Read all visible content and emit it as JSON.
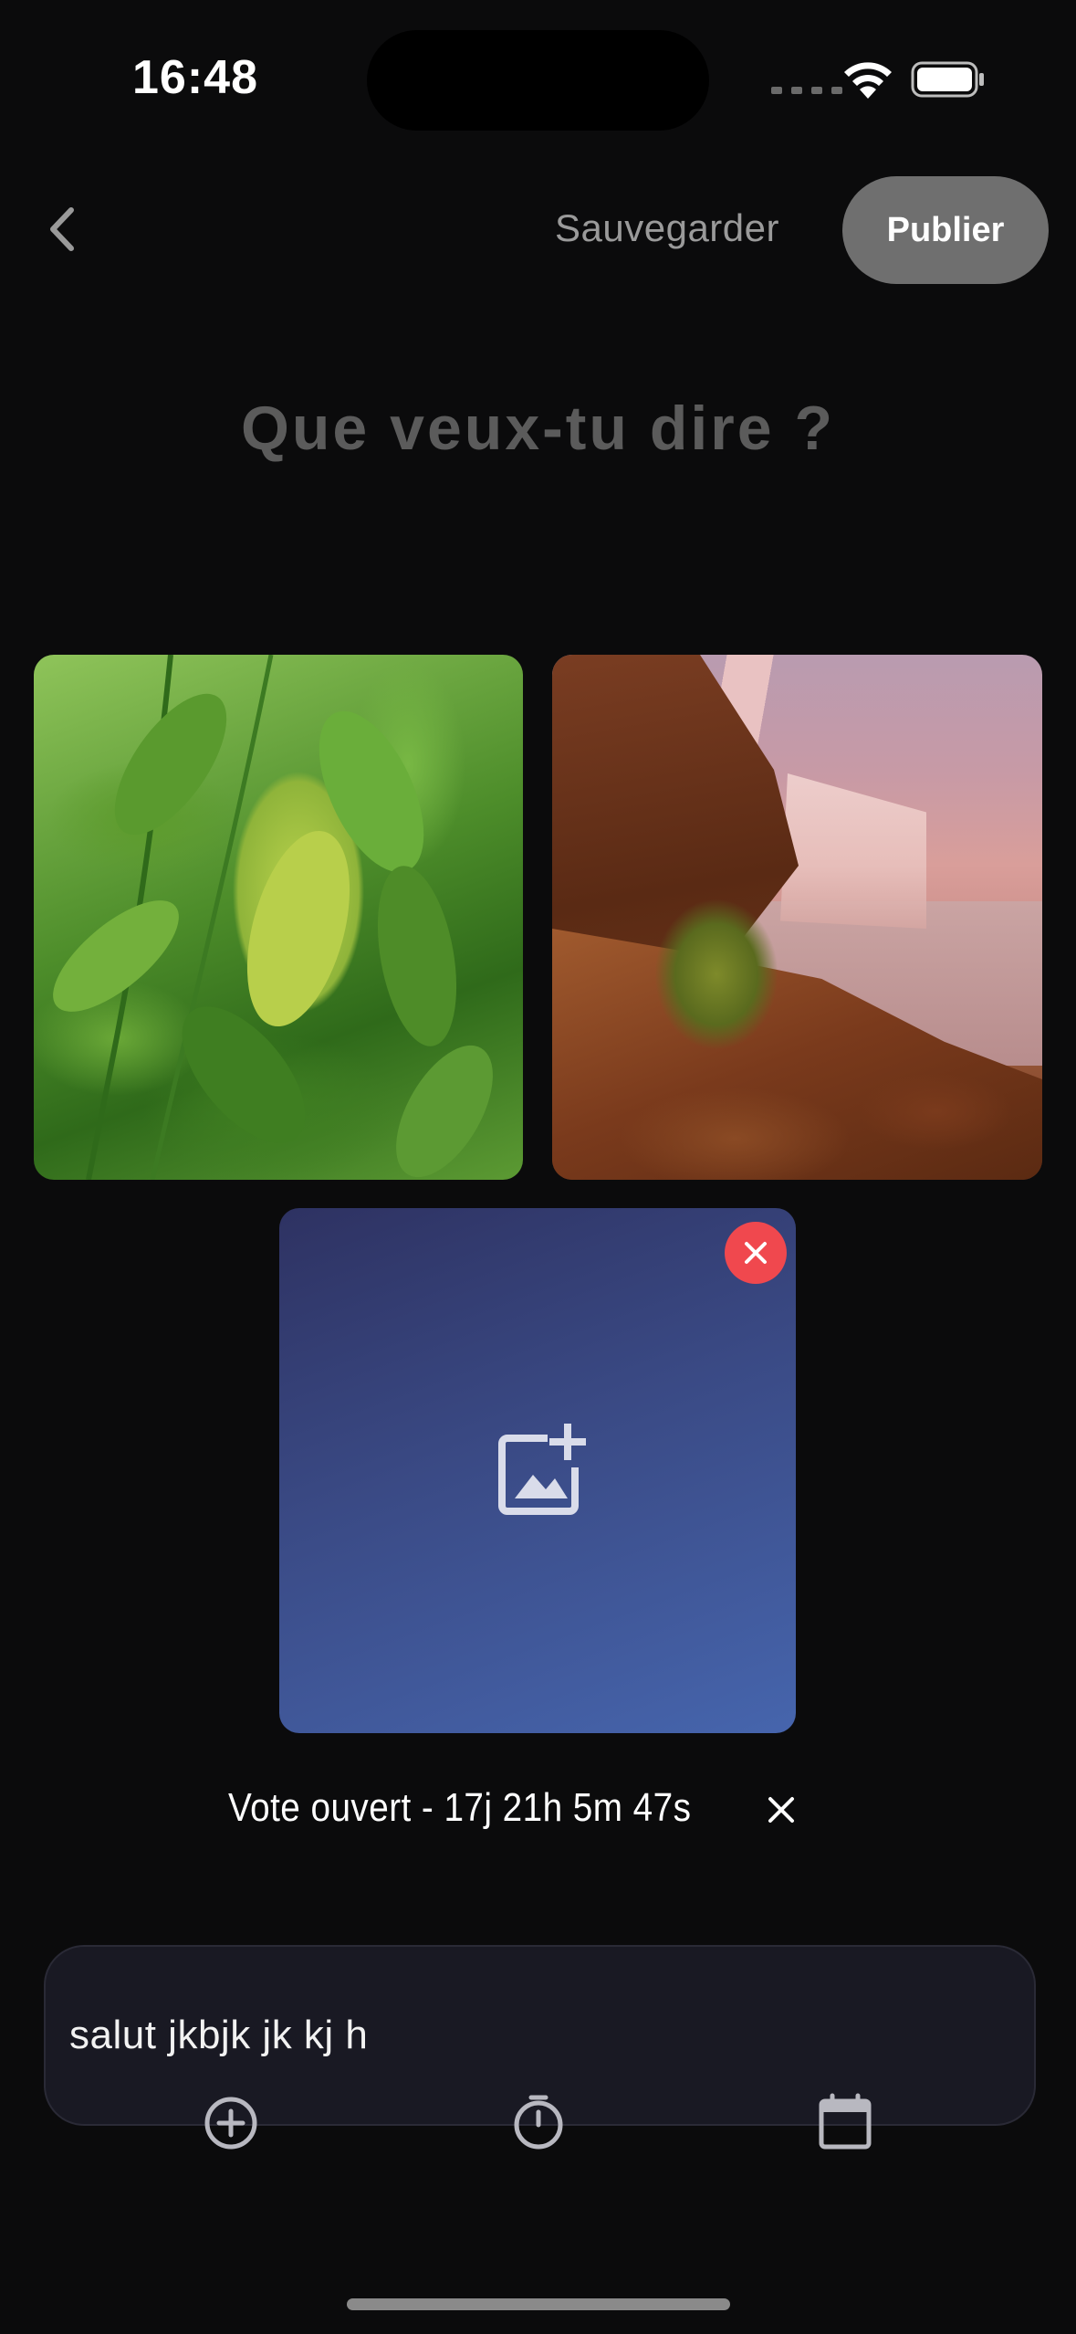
{
  "status_bar": {
    "time": "16:48",
    "icons": [
      "signal-icon",
      "wifi-icon",
      "battery-icon"
    ]
  },
  "header": {
    "back_icon": "chevron-left-icon",
    "save_label": "Sauvegarder",
    "publish_label": "Publier"
  },
  "prompt": {
    "title": "Que veux-tu dire ?"
  },
  "images": [
    {
      "description_icon": "photo-leaves"
    },
    {
      "description_icon": "photo-waterfall"
    }
  ],
  "add_card": {
    "icon": "add-image-icon",
    "remove_icon": "close-icon"
  },
  "vote": {
    "status": "Vote ouvert - ",
    "countdown": "17j 21h 5m 47s",
    "close_icon": "close-icon"
  },
  "composer": {
    "text": "salut jkbjk jk kj h",
    "tools": [
      "add-circle-icon",
      "timer-icon",
      "calendar-icon"
    ]
  },
  "colors": {
    "background": "#0b0b0c",
    "publish_button": "#6f6f6f",
    "remove_button": "#f0484e",
    "add_card_gradient_start": "#2e3262",
    "add_card_gradient_end": "#4665ad",
    "composer_background": "#191923"
  }
}
